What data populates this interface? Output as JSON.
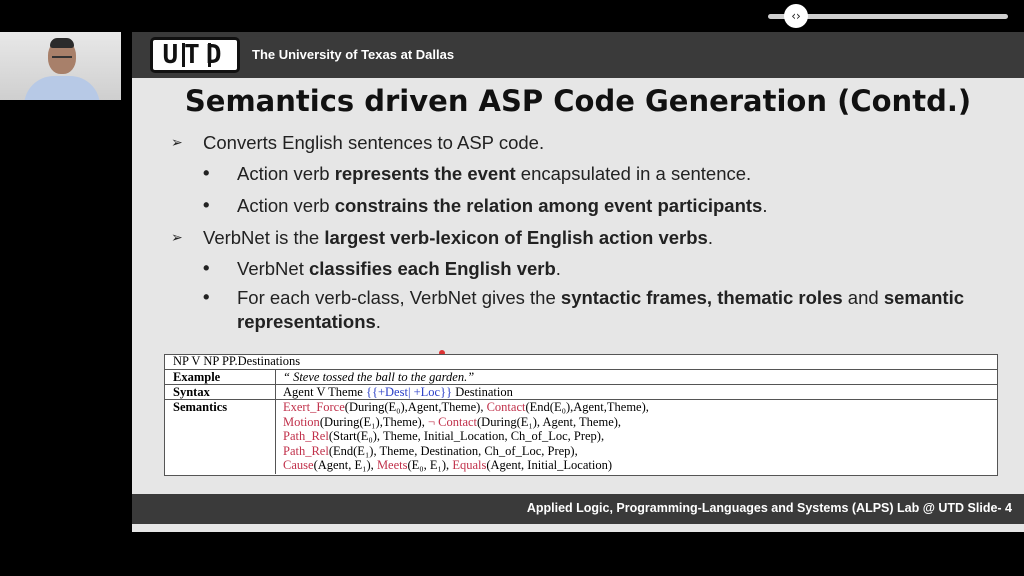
{
  "player": {
    "scrubber_icon": "chevron-left-right"
  },
  "header": {
    "logo": "UTD",
    "university": "The University of Texas at Dallas"
  },
  "title": "Semantics driven ASP Code Generation (Contd.)",
  "bullets": {
    "b1": "Converts English sentences to ASP code.",
    "b1_1": [
      "Action verb ",
      "represents the event",
      " encapsulated in a sentence."
    ],
    "b1_2": [
      "Action verb ",
      "constrains the relation among event participants",
      "."
    ],
    "b2": [
      "VerbNet is the ",
      "largest verb-lexicon of English action verbs",
      "."
    ],
    "b2_1": [
      "VerbNet ",
      "classifies each English verb",
      "."
    ],
    "b2_2": [
      "For each verb-class, VerbNet gives the ",
      "syntactic frames, thematic roles",
      " and ",
      "semantic representations",
      "."
    ]
  },
  "table": {
    "header": "NP V NP PP.Destinations",
    "example_label": "Example",
    "example": "“ Steve tossed the ball to the garden.”",
    "syntax_label": "Syntax",
    "syntax_a": "Agent V Theme ",
    "syntax_b": "{{+Dest",
    "syntax_c": "| +Loc}}",
    "syntax_d": " Destination",
    "semantics_label": "Semantics",
    "sem": [
      [
        "Exert_Force",
        "(During(E₀),Agent,Theme), ",
        "Contact",
        "(End(E₀),Agent,Theme),"
      ],
      [
        "Motion",
        "(During(E₁),Theme), ",
        "¬ Contact",
        "(During(E₁), Agent, Theme),"
      ],
      [
        "Path_Rel",
        "(Start(E₀), Theme, Initial_Location, Ch_of_Loc, Prep),",
        "",
        ""
      ],
      [
        "Path_Rel",
        "(End(E₁), Theme, Destination, Ch_of_Loc, Prep),",
        "",
        ""
      ],
      [
        "Cause",
        "(Agent, E₁), ",
        "Meets",
        "(E₀, E₁), "
      ]
    ],
    "sem_last_extra": [
      "Equals",
      "(Agent, Initial_Location)"
    ]
  },
  "footer": "Applied Logic, Programming-Languages and Systems (ALPS) Lab @ UTD  Slide- 4"
}
